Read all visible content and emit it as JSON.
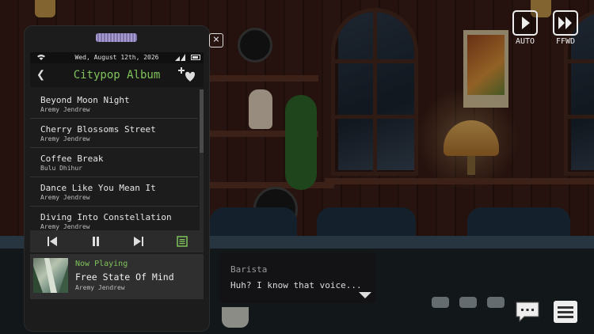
{
  "phone": {
    "status": {
      "date": "Wed, August 12th, 2026"
    },
    "header": {
      "title": "Citypop Album"
    },
    "tracks": [
      {
        "title": "Beyond Moon Night",
        "artist": "Aremy Jendrew"
      },
      {
        "title": "Cherry Blossoms Street",
        "artist": "Aremy Jendrew"
      },
      {
        "title": "Coffee Break",
        "artist": "Bulu Dhihur"
      },
      {
        "title": "Dance Like You Mean It",
        "artist": "Aremy Jendrew"
      },
      {
        "title": "Diving Into Constellation",
        "artist": "Aremy Jendrew"
      }
    ],
    "now_playing": {
      "label": "Now Playing",
      "title": "Free State Of Mind",
      "artist": "Aremy Jendrew"
    }
  },
  "controls": {
    "auto_label": "AUTO",
    "ffwd_label": "FFWD"
  },
  "dialogue": {
    "speaker": "Barista",
    "text": "Huh? I know that voice..."
  },
  "colors": {
    "accent_green": "#7fc35a"
  }
}
